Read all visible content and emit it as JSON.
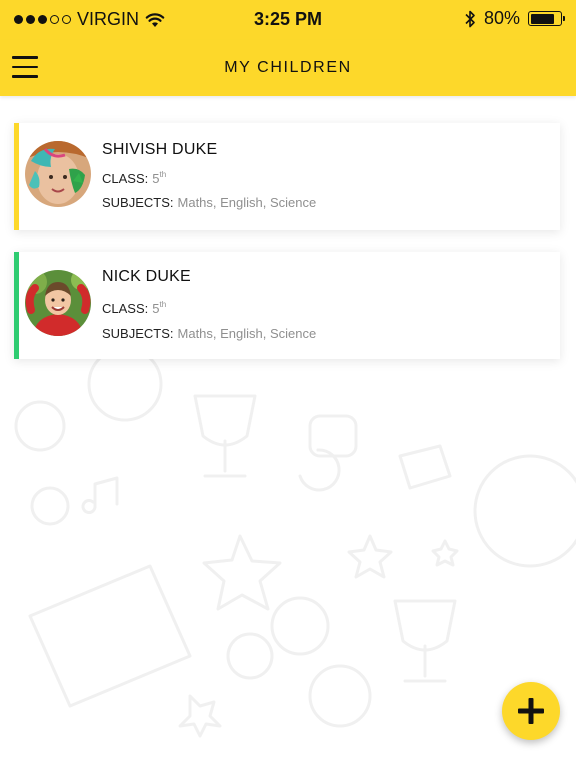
{
  "status_bar": {
    "carrier": "VIRGIN",
    "time": "3:25 PM",
    "battery_text": "80%",
    "battery_level": 0.8,
    "signal_filled": 3,
    "signal_total": 5
  },
  "header": {
    "title": "MY CHILDREN"
  },
  "labels": {
    "class": "CLASS:",
    "subjects": "SUBJECTS:"
  },
  "children": [
    {
      "name": "SHIVISH DUKE",
      "class_value": "5",
      "class_suffix": "th",
      "subjects": "Maths, English, Science",
      "accent": "#fdd82a"
    },
    {
      "name": "NICK DUKE",
      "class_value": "5",
      "class_suffix": "th",
      "subjects": "Maths, English, Science",
      "accent": "#2ecc71"
    }
  ],
  "colors": {
    "brand_yellow": "#fdd82a",
    "accent_green": "#2ecc71"
  },
  "icons": {
    "menu": "hamburger-menu-icon",
    "add": "plus-icon",
    "wifi": "wifi-icon",
    "bluetooth": "bluetooth-icon",
    "battery": "battery-icon"
  }
}
